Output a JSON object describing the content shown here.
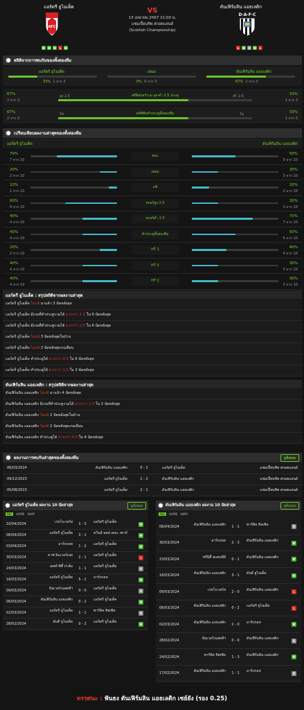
{
  "header": {
    "home": "แอร์ดรี ยูไนเต็ด",
    "away": "ดันเฟิร์มลิน แอธเลติก",
    "vs": "VS",
    "date": "13 เมษายน 2567 21:00 น.",
    "league": "แชมเปี้ยนชิพ สกอตแลนด์ (Scottish Championship)",
    "home_form": [
      "W",
      "W",
      "W",
      "L",
      "W"
    ],
    "away_form": [
      "L",
      "W",
      "D",
      "W",
      "L"
    ],
    "home_crest": "Airdrie crest (red/black shield with AFC)",
    "away_crest": "Dunfermline crest (black/white striped shield with DAFC)"
  },
  "overview": {
    "title": "สถิติจากการพบกันของทั้งสองทีม",
    "home_label": "แอร์ดรี ยูไนเต็ด",
    "draw_label": "เสมอ",
    "away_label": "ดันเฟิร์มลิน แอธเลติก",
    "home_pct": "33%",
    "home_cnt": "1 จาก 3",
    "draw_pct": "0%",
    "draw_cnt": "0 จาก 3",
    "away_pct": "67%",
    "away_cnt": "2 จาก 3",
    "home_val": 0.33,
    "draw_val": 0,
    "away_val": 0.67,
    "rows": [
      {
        "lp": "67%",
        "lc": "2 จาก 3",
        "ltag": "สูง 2.5",
        "label": "สถิติสกอร์รวม สูง-ต่ำ 2.5 ประตู",
        "rtag": "ต่ำ 2.5",
        "rp": "33%",
        "rc": "1 จาก 3",
        "lval": 0.67,
        "rval": 0.33
      },
      {
        "lp": "67%",
        "lc": "2 จาก 3",
        "ltag": "ใช่",
        "label": "สถิติทีมทำประตูทั้งสองทีม",
        "rtag": "ไม่",
        "rp": "33%",
        "rc": "1 จาก 3",
        "lval": 0.67,
        "rval": 0.33
      }
    ]
  },
  "compare": {
    "title": "เปรียบเทียบผลงานล่าสุดของทั้งสองทีม",
    "home_label": "แอร์ดรี ยูไนเต็ด",
    "away_label": "ดันเฟิร์มลิน แอธเลติก",
    "rows": [
      {
        "label": "ชนะ",
        "lp": "70%",
        "lc": "7 จาก 10",
        "rp": "50%",
        "rc": "5 จาก 10",
        "lval": 0.7,
        "rval": 0.5
      },
      {
        "label": "เสมอ",
        "lp": "20%",
        "lc": "2 จาก 10",
        "rp": "30%",
        "rc": "3 จาก 10",
        "lval": 0.2,
        "rval": 0.3
      },
      {
        "label": "แพ้",
        "lp": "10%",
        "lc": "1 จาก 10",
        "rp": "20%",
        "rc": "2 จาก 10",
        "lval": 0.1,
        "rval": 0.2
      },
      {
        "label": "สกอร์สูง 2.5",
        "lp": "60%",
        "lc": "6 จาก 10",
        "rp": "30%",
        "rc": "3 จาก 10",
        "lval": 0.6,
        "rval": 0.3
      },
      {
        "label": "สกอร์ต่ำ 2.5",
        "lp": "40%",
        "lc": "4 จาก 10",
        "rp": "70%",
        "rc": "7 จาก 10",
        "lval": 0.4,
        "rval": 0.7
      },
      {
        "label": "ทำประตูทั้งสองทีม",
        "lp": "40%",
        "lc": "4 จาก 10",
        "rp": "50%",
        "rc": "5 จาก 10",
        "lval": 0.4,
        "rval": 0.5
      },
      {
        "label": "HT 1",
        "lp": "20%",
        "lc": "2 จาก 10",
        "rp": "40%",
        "rc": "4 จาก 10",
        "lval": 0.2,
        "rval": 0.4
      },
      {
        "label": "HT X",
        "lp": "40%",
        "lc": "4 จาก 10",
        "rp": "30%",
        "rc": "3 จาก 10",
        "lval": 0.4,
        "rval": 0.3
      },
      {
        "label": "HT 2",
        "lp": "40%",
        "lc": "4 จาก 10",
        "rp": "30%",
        "rc": "3 จาก 10",
        "lval": 0.4,
        "rval": 0.3
      }
    ]
  },
  "home_summary": {
    "title": "แอร์ดรี ยูไนเต็ด : สรุปสถิติจากผลงานล่าสุด",
    "lines": [
      {
        "a": "แอร์ดรี ยูไนเต็ด",
        "b": "ไม่แพ้",
        "c": "มาแล้ว 3 นัดหลังสุด"
      },
      {
        "a": "แอร์ดรี ยูไนเต็ด มีเกมที่ทำประตูรวมได้",
        "b": "มากกว่า 1.5",
        "c": "ใน 6 นัดหลังสุด"
      },
      {
        "a": "แอร์ดรี ยูไนเต็ด มีเกมที่ทำประตูรวมได้",
        "b": "มากกว่า 2.5",
        "c": "ใน 6 นัดหลังสุด"
      },
      {
        "a": "แอร์ดรี ยูไนเต็ด",
        "b": "ไม่แพ้",
        "c": "3 นัดหลังสุดในบ้าน"
      },
      {
        "a": "แอร์ดรี ยูไนเต็ด",
        "b": "ไม่แพ้",
        "c": "2 นัดหลังสุดเกมเยือน"
      },
      {
        "a": "แอร์ดรี ยูไนเต็ด ทำประตูได้",
        "b": "มากกว่า 0.5",
        "c": "ใน 6 นัดหลังสุด"
      },
      {
        "a": "แอร์ดรี ยูไนเต็ด ทำประตูได้",
        "b": "มากกว่า 1.5",
        "c": "ใน 3 นัดหลังสุด"
      }
    ]
  },
  "away_summary": {
    "title": "ดันเฟิร์มลิน แอธเลติก : สรุปสถิติจากผลงานล่าสุด",
    "lines": [
      {
        "a": "ดันเฟิร์มลิน แอธเลติก",
        "b": "ไม่แพ้",
        "c": "มาแล้ว 4 นัดหลังสุด"
      },
      {
        "a": "ดันเฟิร์มลิน แอธเลติก มีเกมที่ทำประตูรวมได้",
        "b": "มากกว่า 1.5",
        "c": "ใน 2 นัดหลังสุด"
      },
      {
        "a": "ดันเฟิร์มลิน แอธเลติก",
        "b": "ไม่แพ้",
        "c": "2 นัดหลังสุดในบ้าน"
      },
      {
        "a": "ดันเฟิร์มลิน แอธเลติก",
        "b": "ไม่แพ้",
        "c": "2 นัดหลังสุดเกมเยือน"
      },
      {
        "a": "ดันเฟิร์มลิน แอธเลติก ทำประตูได้",
        "b": "มากกว่า 0.5",
        "c": "ใน 4 นัดหลังสุด"
      }
    ]
  },
  "h2h": {
    "title": "ผลงานการพบกันล่าสุดของทั้งสองทีม",
    "button": "ดูทั้งหมด",
    "rows": [
      {
        "date": "06/03/2024",
        "home": "ดันเฟิร์มลิน แอธเลติก",
        "score": "0 - 2",
        "away": "แอร์ดรี ยูไนเต็ด",
        "league": "แชมเปี้ยนชิพ สกอตแลนด์"
      },
      {
        "date": "09/12/2023",
        "home": "แอร์ดรี ยูไนเต็ด",
        "score": "1 - 2",
        "away": "ดันเฟิร์มลิน แอธเลติก",
        "league": "แชมเปี้ยนชิพ สกอตแลนด์"
      },
      {
        "date": "05/08/2023",
        "home": "แอร์ดรี ยูไนเต็ด",
        "score": "2 - 1",
        "away": "ดันเฟิร์มลิน แอธเลติก",
        "league": "แชมเปี้ยนชิพ สกอตแลนด์"
      }
    ]
  },
  "home_last10": {
    "title": "แอร์ดรี ยูไนเต็ด ผลงาน 10 นัดล่าสุด",
    "button": "ดูทั้งหมด",
    "tabs": [
      "ALL",
      "HOME",
      "AWAY"
    ],
    "rows": [
      {
        "date": "10/04/2024",
        "home": "เรธโรเวอร์ส",
        "score": "1 - 3",
        "away": "แอร์ดรี ยูไนเต็ด",
        "r": "W"
      },
      {
        "date": "06/04/2024",
        "home": "แอร์ดรี ยูไนเต็ด",
        "score": "3 - 1",
        "away": "ควีนส์ ออฟ เดอะ เซาท์",
        "r": "W"
      },
      {
        "date": "03/04/2024",
        "home": "อาร์บรอท",
        "score": "1 - 2",
        "away": "แอร์ดรี ยูไนเต็ด",
        "r": "W"
      },
      {
        "date": "30/03/2024",
        "home": "ดาฟ อินเวอร์เนส",
        "score": "2 - 1",
        "away": "แอร์ดรี ยูไนเต็ด",
        "r": "L"
      },
      {
        "date": "24/03/2024",
        "home": "เลสท์ ซิตี้ ปาล์ม",
        "score": "1 - 1",
        "away": "แอร์ดรี ยูไนเต็ด",
        "r": "D"
      },
      {
        "date": "16/03/2024",
        "home": "แอร์ดรี ยูไนเต็ด",
        "score": "5 - 2",
        "away": "อาร์บรอท",
        "r": "W"
      },
      {
        "date": "09/03/2024",
        "home": "อินเวอร์เนสคลีฯ",
        "score": "0 - 0",
        "away": "แอร์ดรี ยูไนเต็ด",
        "r": "D"
      },
      {
        "date": "06/03/2024",
        "home": "ดันเฟิร์มลิน แอธเลติก",
        "score": "0 - 2",
        "away": "แอร์ดรี ยูไนเต็ด",
        "r": "W"
      },
      {
        "date": "02/03/2024",
        "home": "แอร์ดรี ยูไนเต็ด",
        "score": "1 - 1",
        "away": "พาร์ทิค ทิสเซิล",
        "r": "D"
      },
      {
        "date": "28/02/2024",
        "home": "ดันดี ยูไนเต็ด",
        "score": "0 - 2",
        "away": "แอร์ดรี ยูไนเต็ด",
        "r": "W"
      }
    ]
  },
  "away_last10": {
    "title": "ดันเฟิร์มลิน แอธเลติก ผลงาน 10 นัดล่าสุด",
    "button": "ดูทั้งหมด",
    "tabs": [
      "ALL",
      "HOME",
      "AWAY"
    ],
    "rows": [
      {
        "date": "06/04/2024",
        "home": "ดันเฟิร์มลิน แอธเลติก",
        "score": "1 - 1",
        "away": "พาร์ทิค ทิสเซิล",
        "r": "D"
      },
      {
        "date": "30/03/2024",
        "home": "อาร์บรอท",
        "score": "2 - 3",
        "away": "ดันเฟิร์มลิน แอธเลติก",
        "r": "W"
      },
      {
        "date": "23/03/2024",
        "home": "ทรีนิตี้ สแตนลีย์",
        "score": "0 - 1",
        "away": "ดันเฟิร์มลิน แอธเลติก",
        "r": "W"
      },
      {
        "date": "16/03/2024",
        "home": "ดันเฟิร์มลิน แอธเลติก",
        "score": "3 - 1",
        "away": "ดันดี ยูไนเต็ด",
        "r": "W"
      },
      {
        "date": "09/03/2024",
        "home": "เรธโรเวอร์ส",
        "score": "2 - 0",
        "away": "ดันเฟิร์มลิน แอธเลติก",
        "r": "L"
      },
      {
        "date": "06/03/2024",
        "home": "ดันเฟิร์มลิน แอธเลติก",
        "score": "0 - 2",
        "away": "แอร์ดรี ยูไนเต็ด",
        "r": "L"
      },
      {
        "date": "02/03/2024",
        "home": "ดันเฟิร์มลิน แอธเลติก",
        "score": "2 - 0",
        "away": "อาร์บรอท",
        "r": "W"
      },
      {
        "date": "28/02/2024",
        "home": "อินเวอร์เนสคลีฯ",
        "score": "0 - 0",
        "away": "ดันเฟิร์มลิน แอธเลติก",
        "r": "D"
      },
      {
        "date": "24/02/2024",
        "home": "พาร์ทิค ทิสเซิล",
        "score": "1 - 3",
        "away": "ดันเฟิร์มลิน แอธเลติก",
        "r": "W"
      },
      {
        "date": "17/02/2024",
        "home": "ดันเฟิร์มลิน แอธเลติก",
        "score": "1 - 1",
        "away": "อาร์บรอท",
        "r": "D"
      }
    ]
  },
  "footer": {
    "prefix": "ทรรศนะ :",
    "text": "ฟันธง ดันเฟิร์มลิน แอธเลติก เซย์ยัง (รอง 0.25)"
  },
  "colors": {
    "green": "#6cc32a",
    "cyan": "#44b8c8",
    "red": "#d32a25",
    "yellow": "#ffd21a"
  }
}
